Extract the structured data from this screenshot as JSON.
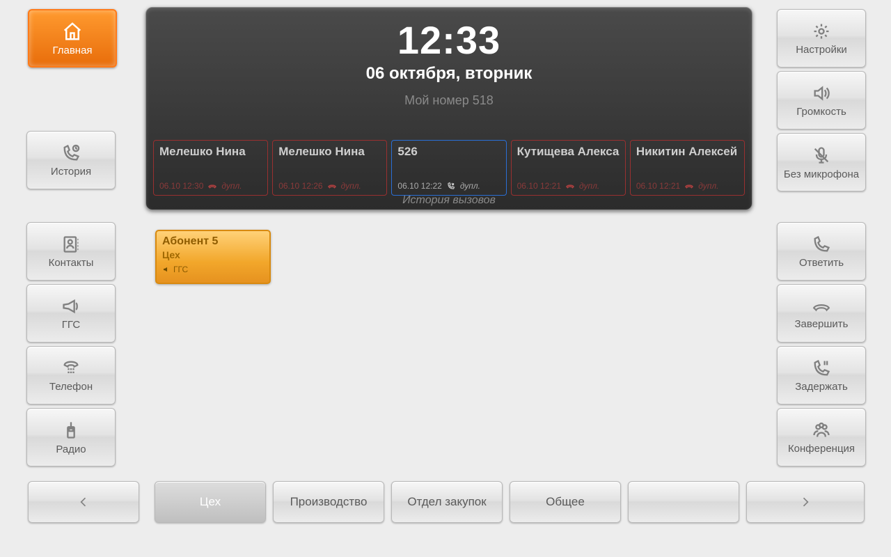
{
  "left": {
    "home": "Главная",
    "history": "История",
    "contacts": "Контакты",
    "ggs": "ГГС",
    "phone": "Телефон",
    "radio": "Радио"
  },
  "right": {
    "settings": "Настройки",
    "volume": "Громкость",
    "mic": "Без микрофона",
    "answer": "Ответить",
    "hangup": "Завершить",
    "hold": "Задержать",
    "conf": "Конференция"
  },
  "header": {
    "time": "12:33",
    "date": "06 октября, вторник",
    "my_number": "Мой номер 518",
    "history_label": "История вызовов",
    "calls": [
      {
        "name": "Мелешко Нина",
        "time": "06.10 12:30",
        "mode": "дупл.",
        "type": "missed"
      },
      {
        "name": "Мелешко Нина",
        "time": "06.10 12:26",
        "mode": "дупл.",
        "type": "missed"
      },
      {
        "name": "526",
        "time": "06.10 12:22",
        "mode": "дупл.",
        "type": "incoming"
      },
      {
        "name": "Кутищева Алекса",
        "time": "06.10 12:21",
        "mode": "дупл.",
        "type": "missed"
      },
      {
        "name": "Никитин Алексей",
        "time": "06.10 12:21",
        "mode": "дупл.",
        "type": "missed"
      }
    ]
  },
  "tile": {
    "name": "Абонент 5",
    "group": "Цех",
    "tag": "ГГС"
  },
  "tabs": [
    "Цех",
    "Производство",
    "Отдел закупок",
    "Общее",
    ""
  ]
}
